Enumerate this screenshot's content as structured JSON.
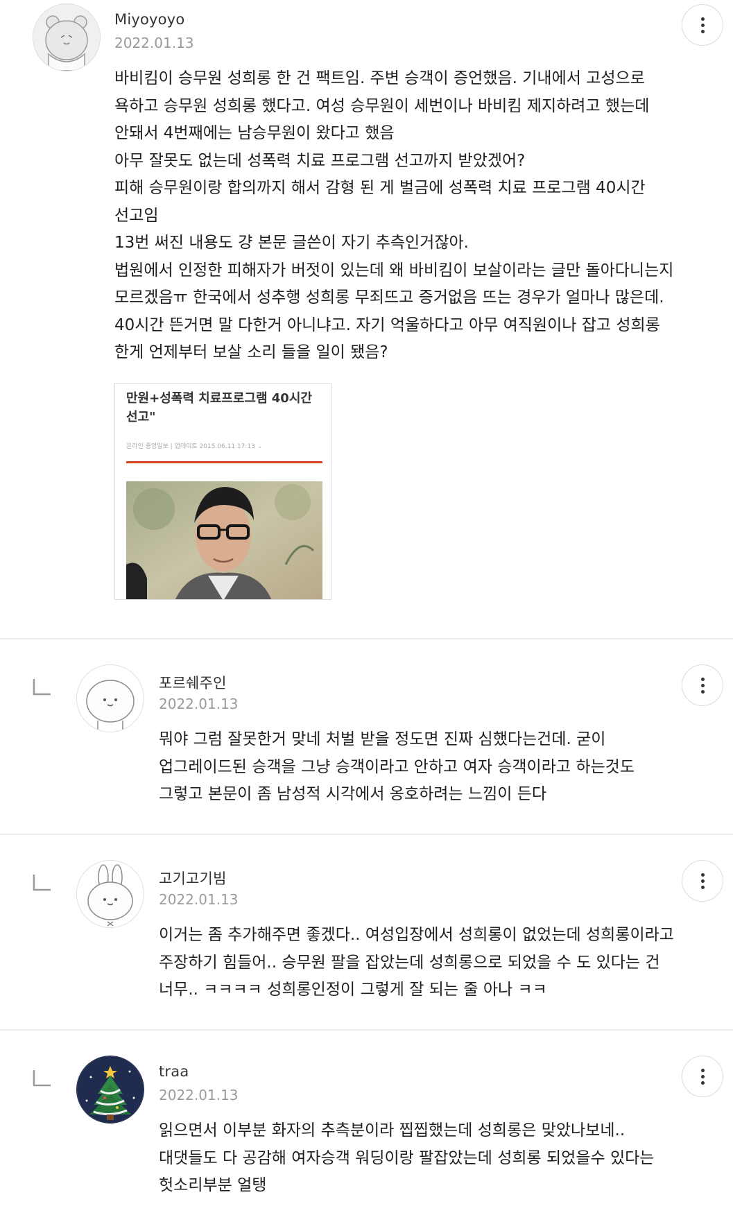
{
  "comments": [
    {
      "author": "Miyoyoyo",
      "date": "2022.01.13",
      "avatar_icon": "bear-avatar-icon",
      "body_lines": [
        "바비킴이 승무원 성희롱 한 건 팩트임. 주변 승객이 증언했음. 기내에서 고성으로",
        "욕하고 승무원 성희롱 했다고. 여성 승무원이 세번이나 바비킴 제지하려고 했는데",
        "안돼서 4번째에는 남승무원이 왔다고 했음",
        "아무 잘못도 없는데 성폭력 치료 프로그램 선고까지 받았겠어?",
        "피해 승무원이랑 합의까지 해서 감형 된 게 벌금에 성폭력 치료 프로그램 40시간",
        "선고임",
        "13번 써진 내용도 걍 본문 글쓴이 자기 추측인거잖아.",
        "법원에서 인정한 피해자가 버젓이 있는데 왜 바비킴이 보살이라는 글만 돌아다니는지",
        "모르겠음ㅠ 한국에서 성추행 성희롱 무죄뜨고 증거없음 뜨는 경우가 얼마나 많은데.",
        "40시간 뜬거면 말 다한거 아니냐고. 자기 억울하다고 아무 여직원이나 잡고 성희롱",
        "한게 언제부터 보살 소리 들을 일이 됐음?"
      ],
      "attachment": {
        "title_lines": [
          "만원+성폭력 치료프로그램 40시간",
          "선고\""
        ],
        "meta": "온라인 중앙일보  |  업데이트 2015.06.11 17:13  ⌄",
        "photo_icon": "news-photo-man-glasses"
      }
    },
    {
      "author": "포르쉐주인",
      "date": "2022.01.13",
      "avatar_icon": "round-face-avatar-icon",
      "body_lines": [
        "뭐야 그럼 잘못한거 맞네 처벌 받을 정도면 진짜 심했다는건데. 굳이",
        "업그레이드된 승객을 그냥 승객이라고 안하고 여자 승객이라고 하는것도",
        "그렇고 본문이 좀 남성적 시각에서 옹호하려는 느낌이 든다"
      ]
    },
    {
      "author": "고기고기빔",
      "date": "2022.01.13",
      "avatar_icon": "bunny-avatar-icon",
      "body_lines": [
        "이거는 좀 추가해주면 좋겠다.. 여성입장에서 성희롱이 없었는데 성희롱이라고",
        "주장하기 힘들어.. 승무원 팔을 잡았는데 성희롱으로 되었을 수 도 있다는 건",
        "너무.. ㅋㅋㅋㅋ 성희롱인정이 그렇게 잘 되는 줄 아나 ㅋㅋ"
      ]
    },
    {
      "author": "traa",
      "date": "2022.01.13",
      "avatar_icon": "christmas-tree-avatar-icon",
      "body_lines": [
        "읽으면서 이부분 화자의 추측분이라 찝찝했는데 성희롱은 맞았나보네..",
        "대댓들도 다 공감해 여자승객 워딩이랑 팔잡았는데 성희롱 되었을수 있다는",
        "헛소리부분 얼탱"
      ]
    }
  ],
  "icons": {
    "more": "more-vertical-icon",
    "reply": "reply-arrow-icon"
  },
  "colors": {
    "accent_rule": "#e0461e",
    "divider": "#ececec",
    "date_text": "#9a9a9a"
  }
}
